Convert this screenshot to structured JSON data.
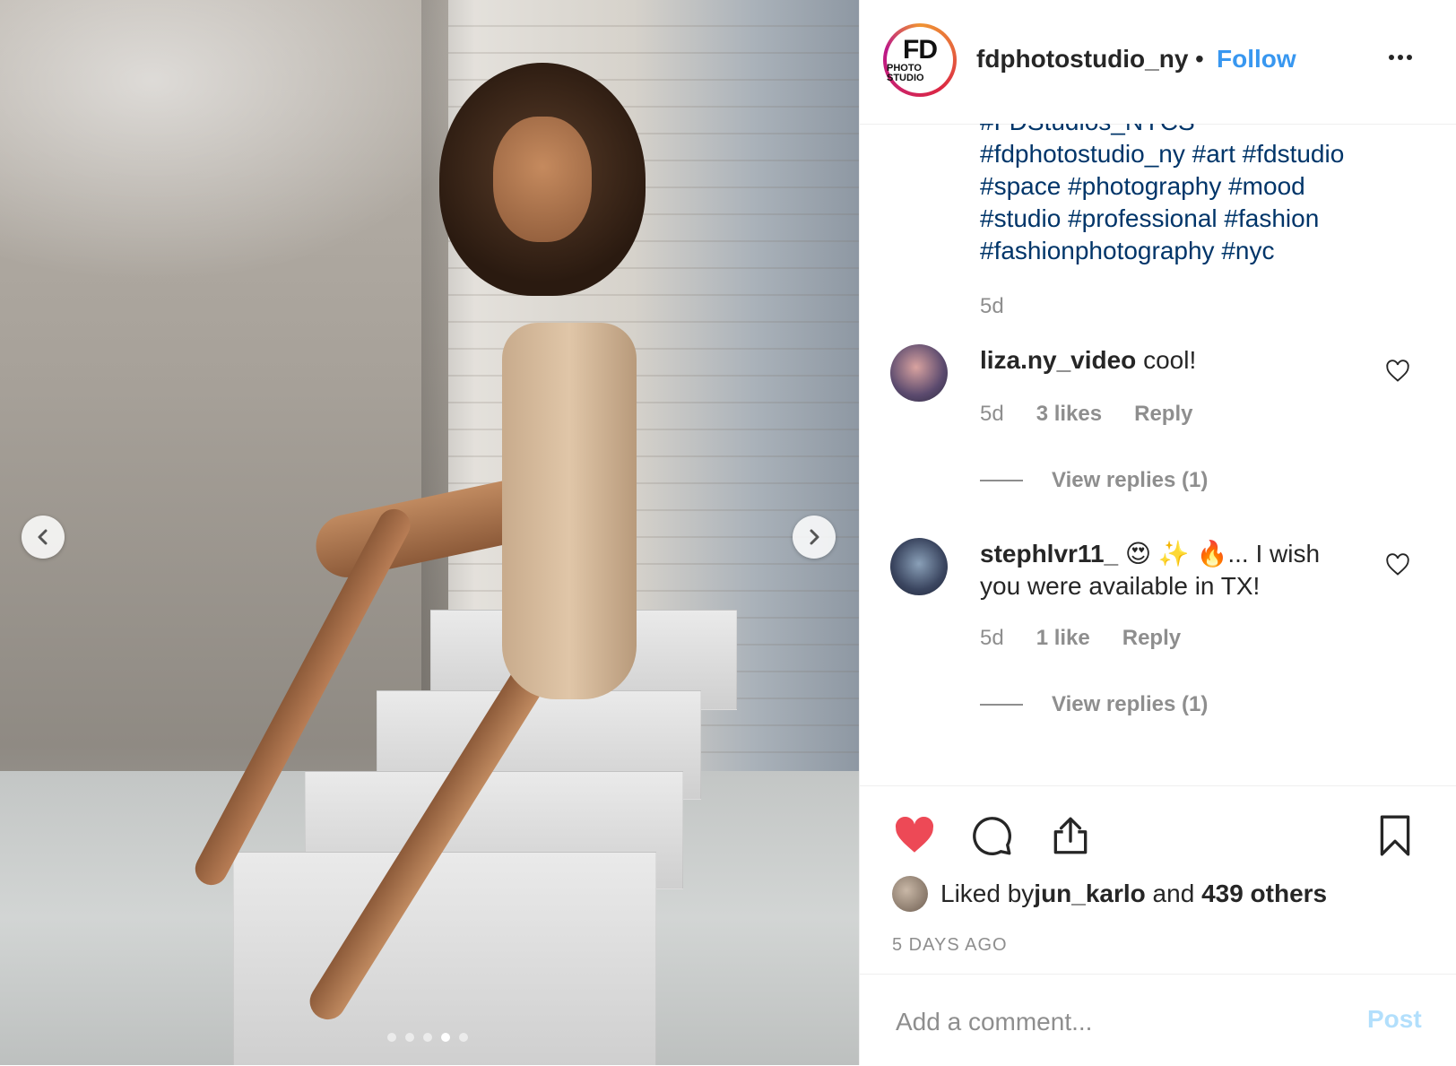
{
  "post": {
    "author": "fdphotostudio_ny",
    "separator": "•",
    "follow_label": "Follow",
    "logo_text_main": "FD",
    "logo_text_sub": "PHOTO STUDIO",
    "carousel": {
      "total_slides": 5,
      "active_slide": 4
    }
  },
  "caption": {
    "lines": [
      "#FDStudios_NYCS",
      "#fdphotostudio_ny #art #fdstudio",
      "#space #photography #mood",
      "#studio #professional #fashion",
      "#fashionphotography #nyc"
    ],
    "time": "5d"
  },
  "comments": [
    {
      "user": "liza.ny_video",
      "text": " cool!",
      "text2": "",
      "time": "5d",
      "likes": "3 likes",
      "reply_label": "Reply",
      "view_replies": "View replies (1)"
    },
    {
      "user": "stephlvr11_",
      "text": " 😍 ✨ 🔥... I wish",
      "text2": "you were available in TX!",
      "time": "5d",
      "likes": "1 like",
      "reply_label": "Reply",
      "view_replies": "View replies (1)"
    }
  ],
  "actions": {
    "liked": true,
    "liked_by_prefix": "Liked by ",
    "liked_by_user": "jun_karlo",
    "liked_by_and": " and ",
    "liked_by_count": "439 others",
    "timestamp": "5 DAYS AGO"
  },
  "add_comment": {
    "placeholder": "Add a comment...",
    "post_label": "Post"
  },
  "colors": {
    "link": "#3897f0",
    "hashtag": "#003569",
    "heart": "#ed4956",
    "muted": "#8e8e8e",
    "post_disabled": "#b2dffc"
  }
}
